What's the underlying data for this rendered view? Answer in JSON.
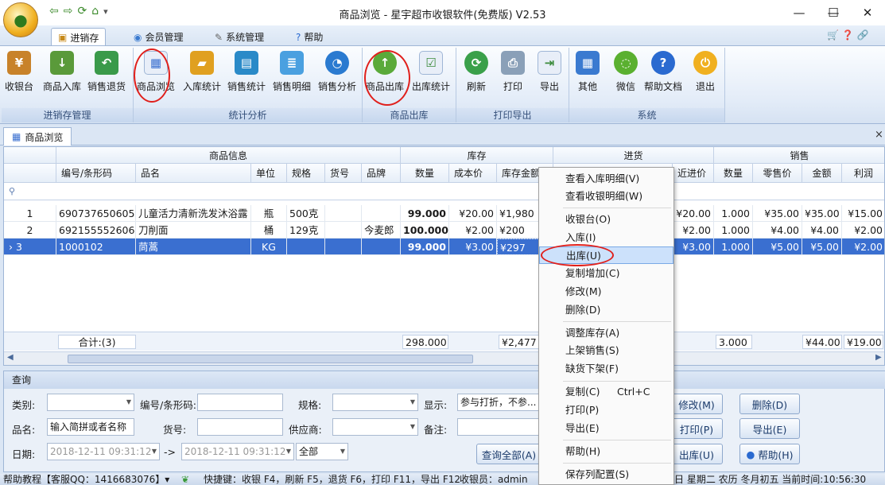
{
  "window": {
    "title": "商品浏览 - 星宇超市收银软件(免费版) V2.53",
    "minimize": "—",
    "maximize": "☐",
    "close": "✕"
  },
  "qat": {
    "back": "⇦",
    "forward": "⇨",
    "refresh": "⟳",
    "home": "⌂",
    "dropdown": "▾"
  },
  "ribbon_tabs": [
    {
      "label": "进销存"
    },
    {
      "label": "会员管理"
    },
    {
      "label": "系统管理"
    },
    {
      "label": "帮助"
    }
  ],
  "ribbon_right_icons": "🛒 ❓ 🔗",
  "ribbon_groups": [
    {
      "title": "进销存管理",
      "buttons": [
        "收银台",
        "商品入库",
        "销售退货"
      ]
    },
    {
      "title": "统计分析",
      "buttons": [
        "商品浏览",
        "入库统计",
        "销售统计",
        "销售明细",
        "销售分析"
      ]
    },
    {
      "title": "商品出库",
      "buttons": [
        "商品出库",
        "出库统计"
      ]
    },
    {
      "title": "打印导出",
      "buttons": [
        "刷新",
        "打印",
        "导出"
      ]
    },
    {
      "title": "系统",
      "buttons": [
        "其他",
        "微信",
        "帮助文档",
        "退出"
      ]
    }
  ],
  "doc_tab": {
    "label": "商品浏览",
    "close": "×"
  },
  "grid": {
    "bands": [
      "商品信息",
      "库存",
      "进货",
      "销售"
    ],
    "columns": [
      "编号/条形码",
      "品名",
      "单位",
      "规格",
      "货号",
      "品牌",
      "数量",
      "成本价",
      "库存金额",
      "近进价",
      "数量",
      "零售价",
      "金额",
      "利润"
    ],
    "filter_icon": "⚲",
    "rows": [
      {
        "no": "1",
        "barcode": "6907376506058",
        "name": "儿童活力清新洗发沐浴露",
        "unit": "瓶",
        "spec": "500克",
        "sku": "",
        "brand": "",
        "qty": "99.000",
        "cost": "¥20.00",
        "stock_amt": "¥1,980",
        "in_price": "¥20.00",
        "sale_qty": "1.000",
        "retail": "¥35.00",
        "amount": "¥35.00",
        "profit": "¥15.00"
      },
      {
        "no": "2",
        "barcode": "6921555526064",
        "name": "刀削面",
        "unit": "桶",
        "spec": "129克",
        "sku": "",
        "brand": "今麦郎",
        "qty": "100.000",
        "cost": "¥2.00",
        "stock_amt": "¥200",
        "in_price": "¥2.00",
        "sale_qty": "1.000",
        "retail": "¥4.00",
        "amount": "¥4.00",
        "profit": "¥2.00"
      },
      {
        "no": "3",
        "barcode": "1000102",
        "name": "茼蒿",
        "unit": "KG",
        "spec": "",
        "sku": "",
        "brand": "",
        "qty": "99.000",
        "cost": "¥3.00",
        "stock_amt": "¥297",
        "in_price": "¥3.00",
        "sale_qty": "1.000",
        "retail": "¥5.00",
        "amount": "¥5.00",
        "profit": "¥2.00"
      }
    ],
    "summary": {
      "label": "合计:(3)",
      "qty": "298.000",
      "stock_amt": "¥2,477",
      "sale_qty": "3.000",
      "amount": "¥44.00",
      "profit": "¥19.00"
    }
  },
  "query": {
    "title": "查询",
    "category_label": "类别:",
    "barcode_label": "编号/条形码:",
    "spec_label": "规格:",
    "display_label": "显示:",
    "display_value": "参与打折，不参...",
    "name_label": "品名:",
    "name_placeholder": "输入简拼或者名称",
    "sku_label": "货号:",
    "supplier_label": "供应商:",
    "note_label": "备注:",
    "date_label": "日期:",
    "date_from": "2018-12-11 09:31:12",
    "date_arrow": "->",
    "date_to": "2018-12-11 09:31:12",
    "all_value": "全部",
    "buttons": {
      "query_all": "查询全部(A)",
      "modify": "修改(M)",
      "delete": "删除(D)",
      "print": "打印(P)",
      "export": "导出(E)",
      "outbound": "出库(U)",
      "help": "帮助(H)"
    }
  },
  "context_menu": [
    {
      "label": "查看入库明细(V)"
    },
    {
      "label": "查看收银明细(W)"
    },
    {
      "label": "收银台(O)"
    },
    {
      "label": "入库(I)"
    },
    {
      "label": "出库(U)"
    },
    {
      "label": "复制增加(C)"
    },
    {
      "label": "修改(M)"
    },
    {
      "label": "删除(D)"
    },
    {
      "label": "调整库存(A)"
    },
    {
      "label": "上架销售(S)"
    },
    {
      "label": "缺货下架(F)"
    },
    {
      "label": "复制(C)",
      "shortcut": "Ctrl+C"
    },
    {
      "label": "打印(P)"
    },
    {
      "label": "导出(E)"
    },
    {
      "label": "帮助(H)"
    },
    {
      "label": "保存列配置(S)"
    }
  ],
  "statusbar": {
    "left": "帮助教程【客服QQ：1416683076】▾",
    "shortcuts": "快捷键：收银 F4，刷新 F5，退货 F6，打印 F11，导出 F12",
    "operator": "收银员：admin",
    "right": "日 星期二 农历 冬月初五 当前时间:10:56:30"
  },
  "colors": {
    "ribbon_bg": "#dbe6f4",
    "selection": "#3a6fd0",
    "highlight_ring": "#e0201c"
  }
}
